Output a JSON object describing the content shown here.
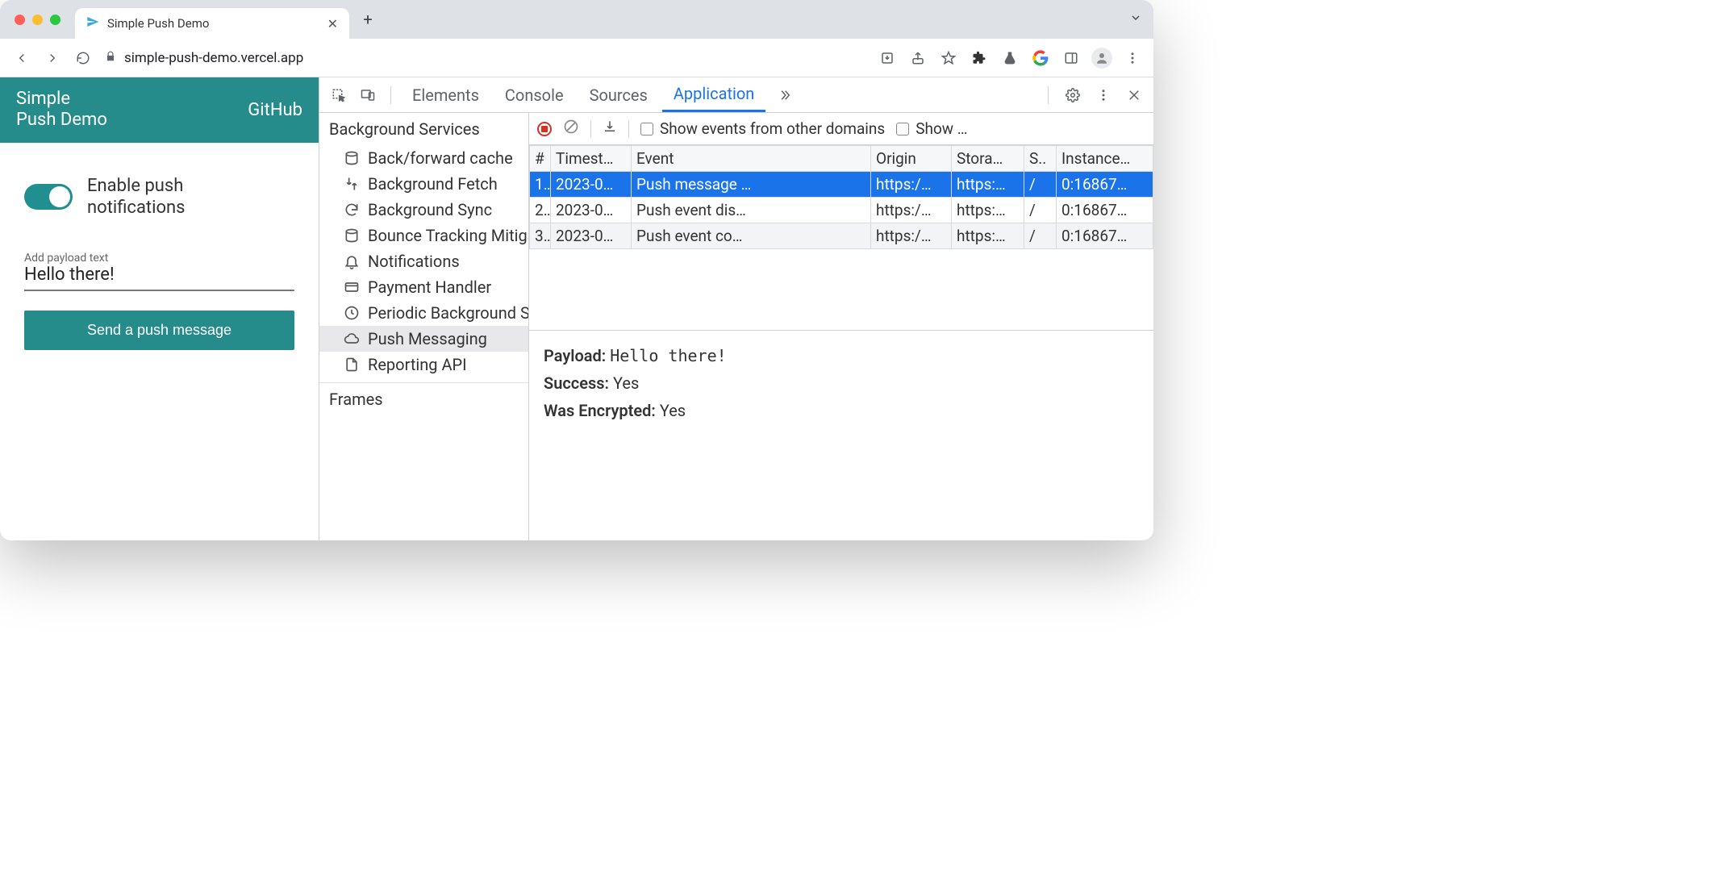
{
  "browser": {
    "tab_title": "Simple Push Demo",
    "url": "simple-push-demo.vercel.app"
  },
  "page": {
    "brand_line1": "Simple",
    "brand_line2": "Push Demo",
    "github": "GitHub",
    "switch_label_line1": "Enable push",
    "switch_label_line2": "notifications",
    "payload_label": "Add payload text",
    "payload_value": "Hello there!",
    "send_button": "Send a push message"
  },
  "devtools": {
    "tabs": {
      "elements": "Elements",
      "console": "Console",
      "sources": "Sources",
      "application": "Application"
    },
    "sidebar": {
      "bg_header": "Background Services",
      "items": [
        "Back/forward cache",
        "Background Fetch",
        "Background Sync",
        "Bounce Tracking Mitigations",
        "Notifications",
        "Payment Handler",
        "Periodic Background Sync",
        "Push Messaging",
        "Reporting API"
      ],
      "frames_header": "Frames"
    },
    "toolbar": {
      "show_other": "Show events from other domains",
      "show_trunc": "Show …"
    },
    "columns": {
      "num": "#",
      "ts": "Timest…",
      "event": "Event",
      "origin": "Origin",
      "storage": "Stora…",
      "sw": "S..",
      "instance": "Instance…"
    },
    "rows": [
      {
        "n": "1.",
        "ts": "2023-0…",
        "event": "Push message …",
        "origin": "https:/…",
        "storage": "https:…",
        "sw": "/",
        "inst": "0:16867…"
      },
      {
        "n": "2.",
        "ts": "2023-0…",
        "event": "Push event dis…",
        "origin": "https:/…",
        "storage": "https:…",
        "sw": "/",
        "inst": "0:16867…"
      },
      {
        "n": "3.",
        "ts": "2023-0…",
        "event": "Push event co…",
        "origin": "https:/…",
        "storage": "https:…",
        "sw": "/",
        "inst": "0:16867…"
      }
    ],
    "details": {
      "payload_k": "Payload:",
      "payload_v": "Hello there!",
      "success_k": "Success:",
      "success_v": "Yes",
      "enc_k": "Was Encrypted:",
      "enc_v": "Yes"
    }
  }
}
